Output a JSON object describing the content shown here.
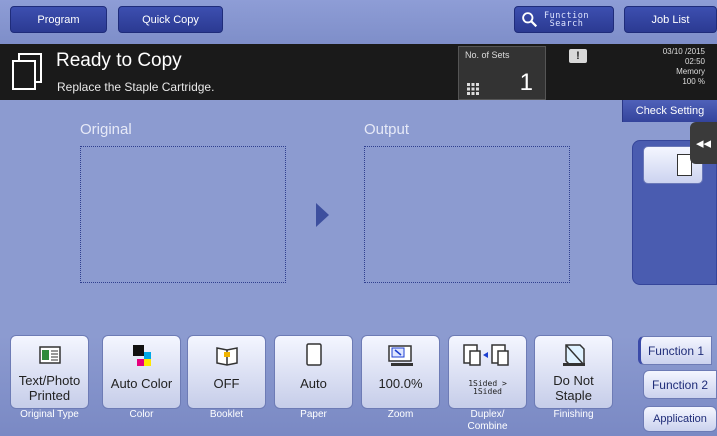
{
  "topbar": {
    "program_label": "Program",
    "quick_copy_label": "Quick Copy",
    "function_search_label_line1": "Function",
    "function_search_label_line2": "Search",
    "job_list_label": "Job List"
  },
  "status": {
    "title": "Ready to Copy",
    "message": "Replace the Staple Cartridge.",
    "sets_label": "No. of Sets",
    "sets_value": "1",
    "alert_badge": "!",
    "date": "03/10 /2015",
    "time": "02:50",
    "memory_label": "Memory",
    "memory_value": "100 %"
  },
  "main": {
    "original_label": "Original",
    "output_label": "Output"
  },
  "right": {
    "check_setting_label": "Check Setting",
    "collapse_label": "◂◂",
    "tabs": {
      "function1": "Function 1",
      "function2": "Function 2",
      "application": "Application"
    }
  },
  "functions": [
    {
      "value_line1": "Text/Photo",
      "value_line2": "Printed",
      "label": "Original Type",
      "icon": "original-type-icon"
    },
    {
      "value_line1": "Auto Color",
      "value_line2": "",
      "label": "Color",
      "icon": "color-icon"
    },
    {
      "value_line1": "OFF",
      "value_line2": "",
      "label": "Booklet",
      "icon": "booklet-icon"
    },
    {
      "value_line1": "Auto",
      "value_line2": "",
      "label": "Paper",
      "icon": "paper-icon"
    },
    {
      "value_line1": "100.0%",
      "value_line2": "",
      "label": "Zoom",
      "icon": "zoom-icon"
    },
    {
      "value_line1": "1Sided >",
      "value_line2": "1Sided",
      "label_line1": "Duplex/",
      "label_line2": "Combine",
      "icon": "duplex-icon"
    },
    {
      "value_line1": "Do Not",
      "value_line2": "Staple",
      "label": "Finishing",
      "icon": "finishing-icon"
    }
  ],
  "colors": {
    "background": "#8c9bd0",
    "status_bar": "#1a1a1a",
    "button_dark_blue": "#2f3f9c",
    "button_light": "#e9ecfa"
  }
}
